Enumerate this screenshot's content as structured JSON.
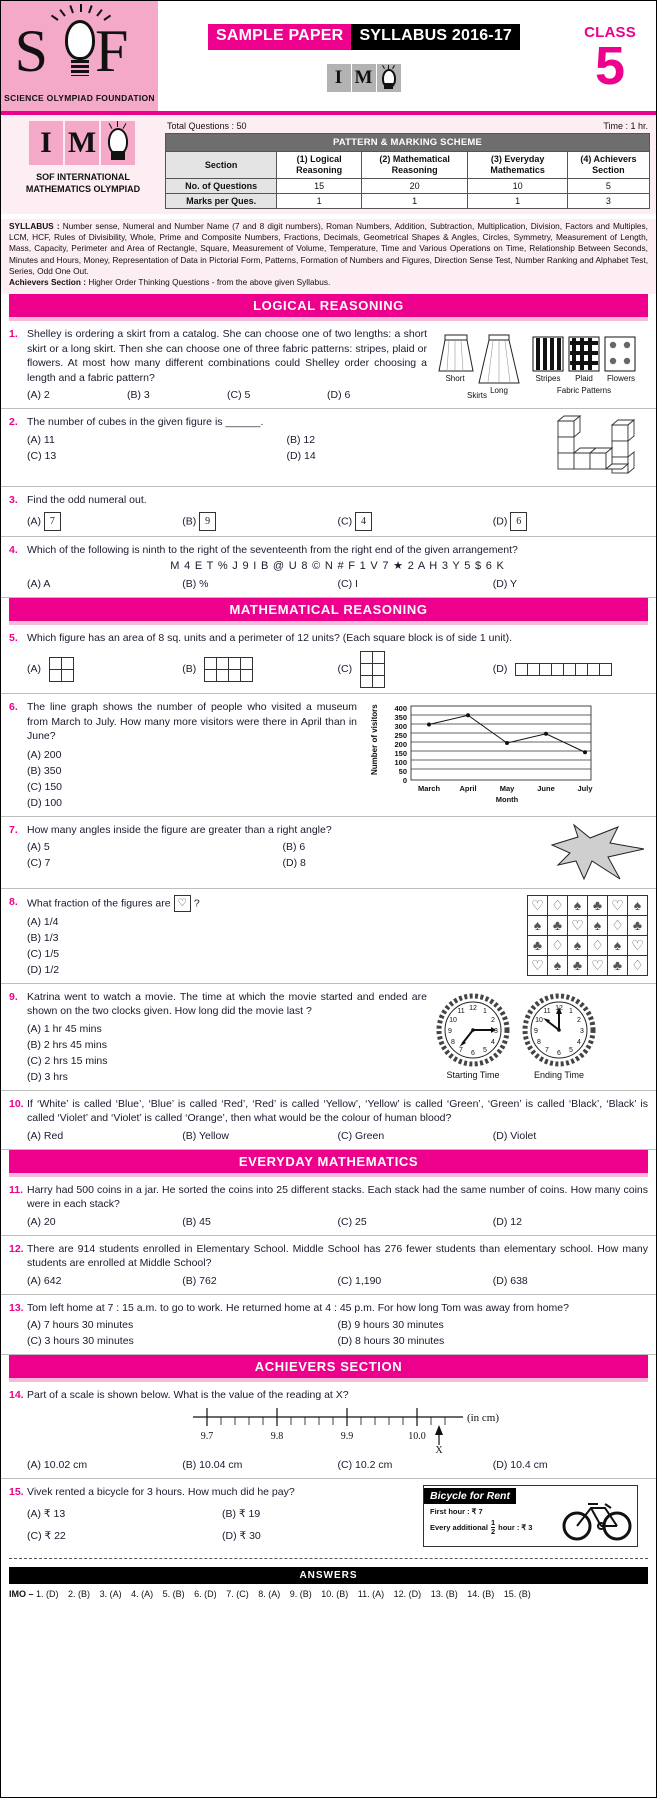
{
  "header": {
    "logo_letters": "S F",
    "logo_caption": "SCIENCE OLYMPIAD FOUNDATION",
    "banner_pink": "SAMPLE PAPER",
    "banner_black": "SYLLABUS 2016-17",
    "imo_i": "I",
    "imo_m": "M",
    "class_label": "CLASS",
    "class_number": "5"
  },
  "info": {
    "org_line1": "SOF INTERNATIONAL",
    "org_line2": "MATHEMATICS OLYMPIAD",
    "total_questions": "Total Questions : 50",
    "time": "Time : 1 hr.",
    "pattern_title": "PATTERN & MARKING SCHEME",
    "pattern": {
      "row_label_header": "Section",
      "columns": [
        "(1) Logical Reasoning",
        "(2) Mathematical Reasoning",
        "(3) Everyday Mathematics",
        "(4) Achievers Section"
      ],
      "rows": [
        {
          "label": "No. of Questions",
          "values": [
            "15",
            "20",
            "10",
            "5"
          ]
        },
        {
          "label": "Marks per Ques.",
          "values": [
            "1",
            "1",
            "1",
            "3"
          ]
        }
      ]
    },
    "syllabus_label": "SYLLABUS :",
    "syllabus_text": " Number sense, Numeral and Number Name (7 and 8 digit numbers), Roman Numbers, Addition, Subtraction, Multiplication, Division, Factors and Multiples, LCM, HCF, Rules of Divisibility, Whole, Prime and Composite Numbers, Fractions, Decimals, Geometrical Shapes & Angles, Circles, Symmetry, Measurement of Length, Mass, Capacity, Perimeter and Area of Rectangle,  Square, Measurement of Volume, Temperature, Time and Various Operations on Time, Relationship Between Seconds, Minutes and Hours, Money, Representation of Data in Pictorial Form, Patterns, Formation of Numbers and Figures, Direction Sense Test, Number Ranking and Alphabet Test, Series, Odd One Out.",
    "achievers_label": "Achievers Section :",
    "achievers_text": " Higher Order Thinking Questions - from the above given Syllabus."
  },
  "sections": {
    "logical_reasoning": "LOGICAL REASONING",
    "mathematical_reasoning": "MATHEMATICAL REASONING",
    "everyday_mathematics": "EVERYDAY MATHEMATICS",
    "achievers_section": "ACHIEVERS SECTION"
  },
  "questions": [
    {
      "num": "1.",
      "text": "Shelley is ordering a skirt from a catalog. She can choose one of two lengths: a short skirt or a long skirt. Then she can choose one of three fabric patterns: stripes, plaid or flowers. At most how many different combinations could Shelley order choosing a length and a fabric pattern?",
      "options": [
        "(A)  2",
        "(B)  3",
        "(C)  5",
        "(D)  6"
      ],
      "fig_labels": [
        "Short",
        "Long",
        "Skirts",
        "Stripes",
        "Plaid",
        "Flowers",
        "Fabric Patterns"
      ]
    },
    {
      "num": "2.",
      "text": "The number of cubes in the given figure is ______.",
      "options": [
        "(A)  11",
        "(B)  12",
        "(C)  13",
        "(D)  14"
      ]
    },
    {
      "num": "3.",
      "text": "Find the odd numeral out.",
      "options_boxed": [
        {
          "letter": "(A)",
          "value": "7"
        },
        {
          "letter": "(B)",
          "value": "9"
        },
        {
          "letter": "(C)",
          "value": "4"
        },
        {
          "letter": "(D)",
          "value": "6"
        }
      ]
    },
    {
      "num": "4.",
      "text": "Which of the following is ninth to the right of the seventeenth from the right end of the given arrangement?",
      "arrangement": "M 4 E T % J 9 I B @ U 8 © N # F 1 V 7 ★ 2 A H 3 Y 5 $ 6 K",
      "options": [
        "(A)  A",
        "(B)  %",
        "(C)  I",
        "(D)  Y"
      ]
    },
    {
      "num": "5.",
      "text": "Which figure has an area of 8 sq. units and a perimeter of 12 units? (Each square block is of side 1 unit).",
      "option_letters": [
        "(A)",
        "(B)",
        "(C)",
        "(D)"
      ]
    },
    {
      "num": "6.",
      "text": "The line graph shows the number of people who visited a museum from March to July. How many more visitors were there in April than in June?",
      "options": [
        "(A)  200",
        "(B)  350",
        "(C)  150",
        "(D)  100"
      ]
    },
    {
      "num": "7.",
      "text": "How many angles inside the figure are greater than a right angle?",
      "options": [
        "(A)  5",
        "(B)  6",
        "(C)  7",
        "(D)  8"
      ]
    },
    {
      "num": "8.",
      "text_before": "What fraction of the figures are",
      "text_after": "?",
      "options": [
        "(A)  1/4",
        "(B)  1/3",
        "(C)  1/5",
        "(D)  1/2"
      ],
      "grid": [
        [
          "heart",
          "diamond",
          "spade",
          "club",
          "heart",
          "spade"
        ],
        [
          "spade",
          "club",
          "heart",
          "spade",
          "diamond",
          "club"
        ],
        [
          "club",
          "diamond",
          "spade",
          "diamond",
          "spade",
          "heart"
        ],
        [
          "heart",
          "spade",
          "club",
          "heart",
          "club",
          "diamond"
        ]
      ]
    },
    {
      "num": "9.",
      "text": "Katrina went to watch a movie. The time at which the movie started and ended are shown on the two clocks given. How long did the movie last ?",
      "options": [
        "(A)  1 hr 45 mins",
        "(B)  2 hrs 45 mins",
        "(C)  2 hrs 15 mins",
        "(D)  3 hrs"
      ],
      "clock_captions": [
        "Starting Time",
        "Ending Time"
      ]
    },
    {
      "num": "10.",
      "text": "If ‘White’ is called ‘Blue’, ‘Blue’ is called ‘Red’, ‘Red’ is called ‘Yellow’, ‘Yellow’ is called ‘Green’, ‘Green’ is called ‘Black’, ‘Black’ is called ‘Violet’ and ‘Violet’ is called ‘Orange’, then what would be the colour of human blood?",
      "options": [
        "(A)  Red",
        "(B)  Yellow",
        "(C)  Green",
        "(D)  Violet"
      ]
    },
    {
      "num": "11.",
      "text": "Harry had 500 coins in a jar. He sorted the coins into 25 different stacks. Each stack had the same number of coins. How many coins were in each stack?",
      "options": [
        "(A)  20",
        "(B)  45",
        "(C)  25",
        "(D)  12"
      ]
    },
    {
      "num": "12.",
      "text": "There are 914 students enrolled in Elementary School. Middle School has 276 fewer students than elementary school. How many students are enrolled at Middle School?",
      "options": [
        "(A)  642",
        "(B)  762",
        "(C)  1,190",
        "(D)  638"
      ]
    },
    {
      "num": "13.",
      "text": "Tom left home at 7 : 15 a.m. to go to work. He returned home at 4 : 45 p.m. For how long Tom was away from home?",
      "options": [
        "(A)  7 hours 30 minutes",
        "(B)  9 hours 30 minutes",
        "(C)  3 hours 30 minutes",
        "(D)  8 hours 30 minutes"
      ]
    },
    {
      "num": "14.",
      "text": "Part of a scale is shown below. What is the value of the reading at X?",
      "scale_ticks": [
        "9.7",
        "9.8",
        "9.9",
        "10.0"
      ],
      "scale_unit": "(in cm)",
      "scale_marker": "X",
      "options": [
        "(A)  10.02 cm",
        "(B)  10.04 cm",
        "(C)  10.2 cm",
        "(D)  10.4 cm"
      ]
    },
    {
      "num": "15.",
      "text": "Vivek rented a bicycle for 3 hours. How much did he pay?",
      "options": [
        "(A)  ₹ 13",
        "(B)  ₹ 19",
        "(C)  ₹ 22",
        "(D)  ₹ 30"
      ],
      "sign_title": "Bicycle for Rent",
      "sign_line1": "First hour :  ₹ 7",
      "sign_line2_a": "Every additional",
      "sign_line2_b": "hour : ₹ 3",
      "sign_frac_num": "1",
      "sign_frac_den": "2"
    }
  ],
  "chart_data": {
    "type": "line",
    "title": "",
    "xlabel": "Month",
    "ylabel": "Number of visitors",
    "categories": [
      "March",
      "April",
      "May",
      "June",
      "July"
    ],
    "values": [
      300,
      350,
      200,
      250,
      150
    ],
    "ylim": [
      0,
      400
    ],
    "yticks": [
      0,
      50,
      100,
      150,
      200,
      250,
      300,
      350,
      400
    ],
    "grid": true,
    "legend": "none"
  },
  "answers": {
    "bar_label": "ANSWERS",
    "prefix": "IMO –",
    "items": [
      "1. (D)",
      "2. (B)",
      "3. (A)",
      "4. (A)",
      "5. (B)",
      "6. (D)",
      "7. (C)",
      "8. (A)",
      "9. (B)",
      "10.  (B)",
      "11. (A)",
      "12. (D)",
      "13.  (B)",
      "14. (B)",
      "15.  (B)"
    ]
  }
}
